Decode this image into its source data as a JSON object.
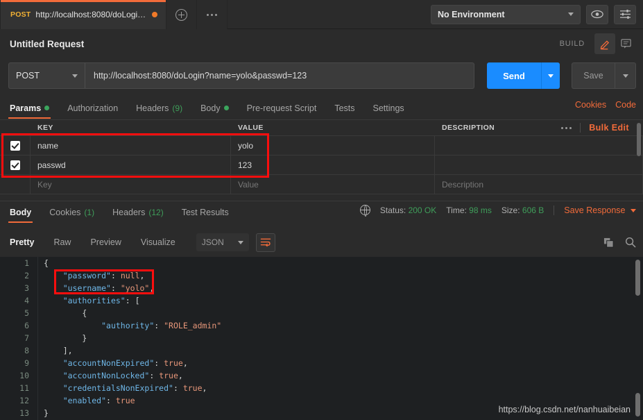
{
  "topbar": {
    "request_tab": {
      "method": "POST",
      "label": "http://localhost:8080/doLogin...",
      "unsaved_indicator": "unsaved-dot"
    },
    "new_tab_icon": "plus-circle-icon",
    "more_tabs_icon": "ellipsis-icon",
    "environment": {
      "selected": "No Environment",
      "caret_icon": "chevron-down-icon"
    },
    "eye_icon": "eye-icon",
    "settings_icon": "sliders-icon"
  },
  "request": {
    "title": "Untitled Request",
    "build_label": "BUILD",
    "edit_icon": "pencil-icon",
    "comment_icon": "comment-icon",
    "method": "POST",
    "url": "http://localhost:8080/doLogin?name=yolo&passwd=123",
    "send_label": "Send",
    "save_label": "Save",
    "tabs": [
      {
        "label": "Params",
        "badge_dot": true,
        "count": "",
        "active": true
      },
      {
        "label": "Authorization",
        "badge_dot": false,
        "count": "",
        "active": false
      },
      {
        "label": "Headers",
        "badge_dot": false,
        "count": "(9)",
        "active": false
      },
      {
        "label": "Body",
        "badge_dot": true,
        "count": "",
        "active": false
      },
      {
        "label": "Pre-request Script",
        "badge_dot": false,
        "count": "",
        "active": false
      },
      {
        "label": "Tests",
        "badge_dot": false,
        "count": "",
        "active": false
      },
      {
        "label": "Settings",
        "badge_dot": false,
        "count": "",
        "active": false
      }
    ],
    "cookies_link": "Cookies",
    "code_link": "Code"
  },
  "params_table": {
    "headers": {
      "key": "KEY",
      "value": "VALUE",
      "description": "DESCRIPTION"
    },
    "more_icon": "ellipsis-icon",
    "bulk_edit_label": "Bulk Edit",
    "rows": [
      {
        "checked": true,
        "key": "name",
        "value": "yolo",
        "description": ""
      },
      {
        "checked": true,
        "key": "passwd",
        "value": "123",
        "description": ""
      }
    ],
    "placeholder_row": {
      "key": "Key",
      "value": "Value",
      "description": "Description"
    }
  },
  "response": {
    "tabs": [
      {
        "label": "Body",
        "count": "",
        "active": true
      },
      {
        "label": "Cookies",
        "count": "(1)",
        "active": false
      },
      {
        "label": "Headers",
        "count": "(12)",
        "active": false
      },
      {
        "label": "Test Results",
        "count": "",
        "active": false
      }
    ],
    "globe_icon": "globe-icon",
    "status_label": "Status:",
    "status_value": "200 OK",
    "time_label": "Time:",
    "time_value": "98 ms",
    "size_label": "Size:",
    "size_value": "606 B",
    "save_response_label": "Save Response",
    "save_response_caret": "chevron-down-icon",
    "view_tabs": [
      {
        "label": "Pretty",
        "active": true
      },
      {
        "label": "Raw",
        "active": false
      },
      {
        "label": "Preview",
        "active": false
      },
      {
        "label": "Visualize",
        "active": false
      }
    ],
    "format": "JSON",
    "wrap_icon": "wrap-lines-icon",
    "copy_icon": "copy-icon",
    "search_icon": "search-icon",
    "body_lines": [
      {
        "n": "1",
        "indent": 0,
        "tokens": [
          {
            "t": "p",
            "v": "{"
          }
        ]
      },
      {
        "n": "2",
        "indent": 1,
        "tokens": [
          {
            "t": "k",
            "v": "\"password\""
          },
          {
            "t": "p",
            "v": ": "
          },
          {
            "t": "lit",
            "v": "null"
          },
          {
            "t": "p",
            "v": ","
          }
        ]
      },
      {
        "n": "3",
        "indent": 1,
        "tokens": [
          {
            "t": "k",
            "v": "\"username\""
          },
          {
            "t": "p",
            "v": ": "
          },
          {
            "t": "s",
            "v": "\"yolo\""
          },
          {
            "t": "p",
            "v": ","
          }
        ]
      },
      {
        "n": "4",
        "indent": 1,
        "tokens": [
          {
            "t": "k",
            "v": "\"authorities\""
          },
          {
            "t": "p",
            "v": ": ["
          }
        ]
      },
      {
        "n": "5",
        "indent": 2,
        "tokens": [
          {
            "t": "p",
            "v": "{"
          }
        ]
      },
      {
        "n": "6",
        "indent": 3,
        "tokens": [
          {
            "t": "k",
            "v": "\"authority\""
          },
          {
            "t": "p",
            "v": ": "
          },
          {
            "t": "s",
            "v": "\"ROLE_admin\""
          }
        ]
      },
      {
        "n": "7",
        "indent": 2,
        "tokens": [
          {
            "t": "p",
            "v": "}"
          }
        ]
      },
      {
        "n": "8",
        "indent": 1,
        "tokens": [
          {
            "t": "p",
            "v": "],"
          }
        ]
      },
      {
        "n": "9",
        "indent": 1,
        "tokens": [
          {
            "t": "k",
            "v": "\"accountNonExpired\""
          },
          {
            "t": "p",
            "v": ": "
          },
          {
            "t": "lit",
            "v": "true"
          },
          {
            "t": "p",
            "v": ","
          }
        ]
      },
      {
        "n": "10",
        "indent": 1,
        "tokens": [
          {
            "t": "k",
            "v": "\"accountNonLocked\""
          },
          {
            "t": "p",
            "v": ": "
          },
          {
            "t": "lit",
            "v": "true"
          },
          {
            "t": "p",
            "v": ","
          }
        ]
      },
      {
        "n": "11",
        "indent": 1,
        "tokens": [
          {
            "t": "k",
            "v": "\"credentialsNonExpired\""
          },
          {
            "t": "p",
            "v": ": "
          },
          {
            "t": "lit",
            "v": "true"
          },
          {
            "t": "p",
            "v": ","
          }
        ]
      },
      {
        "n": "12",
        "indent": 1,
        "tokens": [
          {
            "t": "k",
            "v": "\"enabled\""
          },
          {
            "t": "p",
            "v": ": "
          },
          {
            "t": "lit",
            "v": "true"
          }
        ]
      },
      {
        "n": "13",
        "indent": 0,
        "tokens": [
          {
            "t": "p",
            "v": "}"
          }
        ]
      }
    ]
  },
  "watermark": "https://blog.csdn.net/nanhuaibeian",
  "annotations": {
    "color": "#fb0e0e",
    "boxes": [
      "params-rows-highlight",
      "json-password-username-highlight"
    ]
  }
}
